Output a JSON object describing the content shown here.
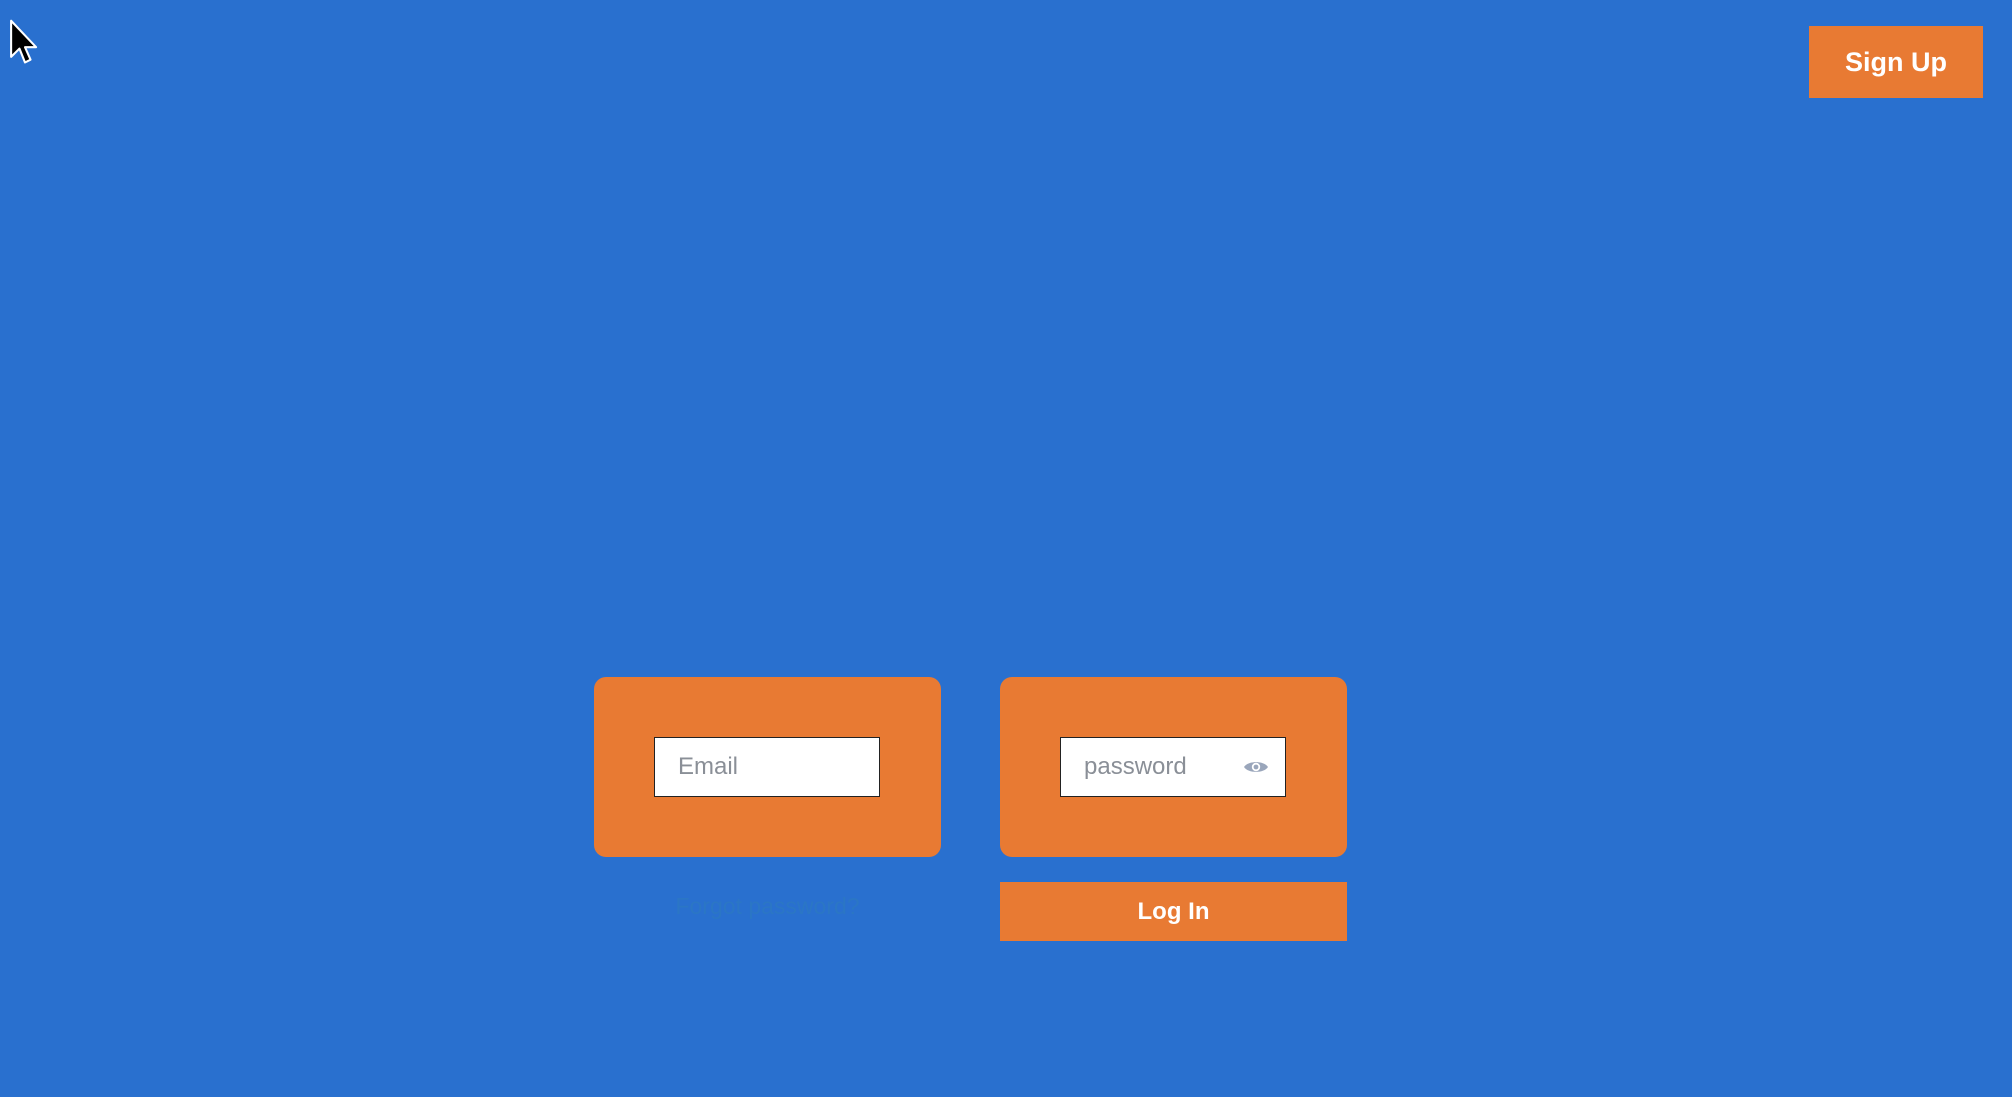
{
  "header": {
    "signup_label": "Sign Up"
  },
  "login_form": {
    "email": {
      "placeholder": "Email",
      "value": ""
    },
    "password": {
      "placeholder": "password",
      "value": "",
      "toggle_icon": "eye-icon"
    },
    "forgot_label": "Forgot password?",
    "login_label": "Log In"
  },
  "colors": {
    "background": "#2970cf",
    "accent": "#e87a33",
    "link": "#2b76c5"
  }
}
